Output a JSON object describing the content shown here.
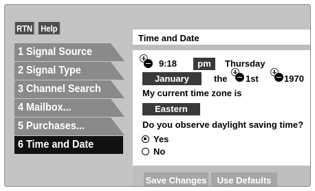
{
  "top_buttons": {
    "rtn": "RTN",
    "help": "Help"
  },
  "menu": {
    "items": [
      {
        "label": "1 Signal Source"
      },
      {
        "label": "2 Signal Type"
      },
      {
        "label": "3 Channel Search"
      },
      {
        "label": "4 Mailbox..."
      },
      {
        "label": "5 Purchases..."
      },
      {
        "label": "6 Time and Date"
      }
    ],
    "active_index": 5
  },
  "header": {
    "title": "Time and Date"
  },
  "time": {
    "value": "9:18",
    "ampm": "pm",
    "weekday": "Thursday"
  },
  "date": {
    "month": "January",
    "the_label": "the",
    "day": "1st",
    "year": "1970"
  },
  "timezone": {
    "label": "My current time zone is",
    "value": "Eastern"
  },
  "dst": {
    "question": "Do you observe daylight saving time?",
    "options": [
      {
        "label": "Yes",
        "selected": true
      },
      {
        "label": "No",
        "selected": false
      }
    ]
  },
  "buttons": {
    "save": "Save Changes",
    "defaults": "Use Defaults"
  },
  "icons": {
    "stepper": "plus-minus-stepper-icon",
    "radio": "radio-icon"
  }
}
